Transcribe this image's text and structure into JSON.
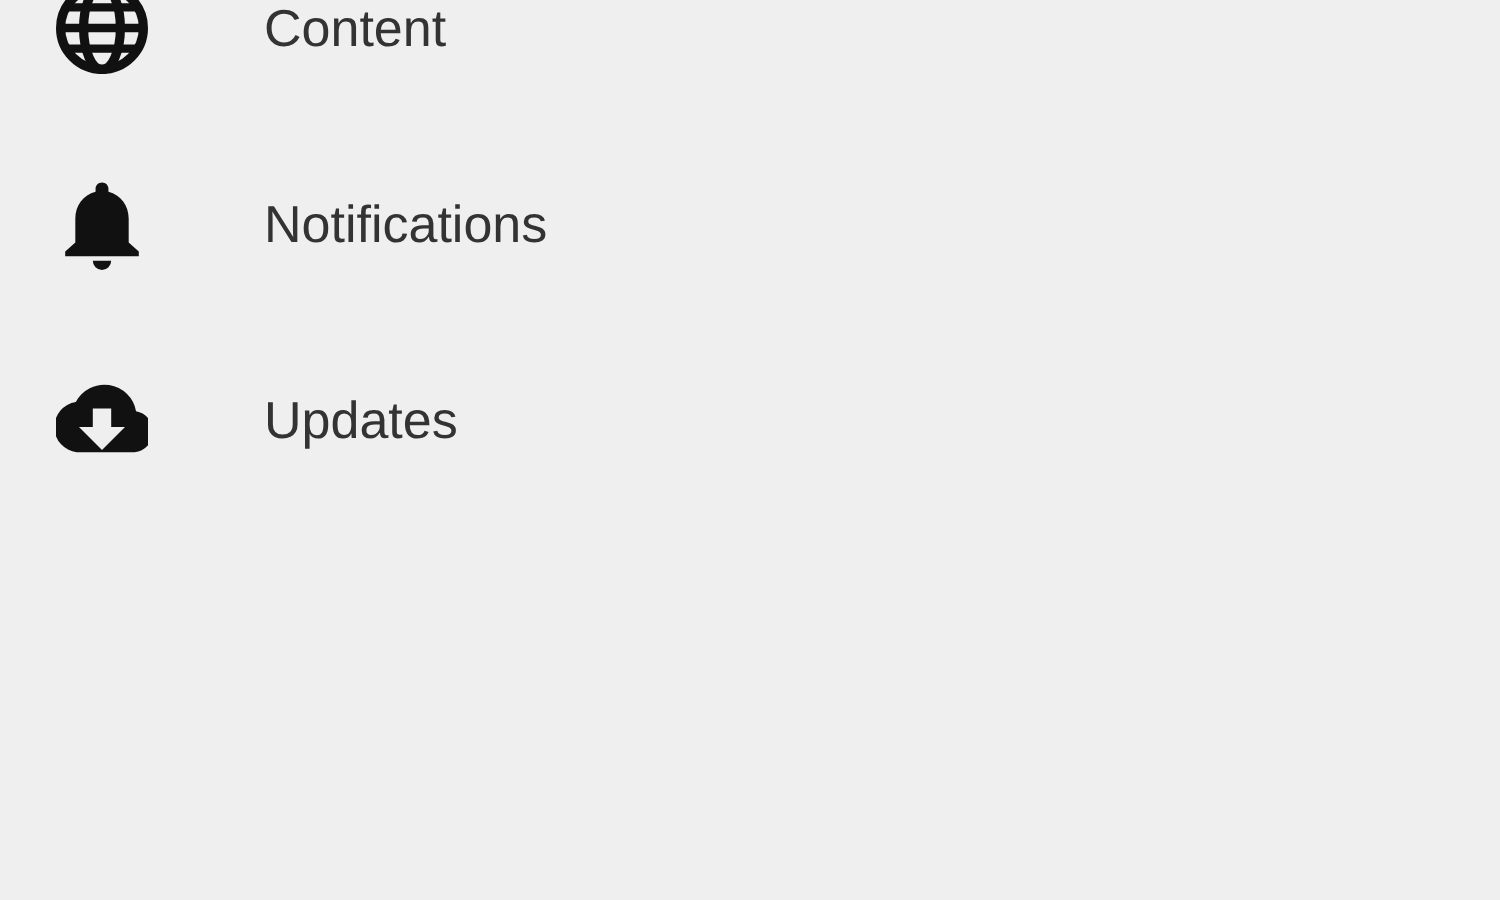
{
  "menu": [
    {
      "kind": "globe",
      "label": "Content"
    },
    {
      "kind": "bell",
      "label": "Notifications"
    },
    {
      "kind": "cloud",
      "label": "Updates"
    }
  ]
}
